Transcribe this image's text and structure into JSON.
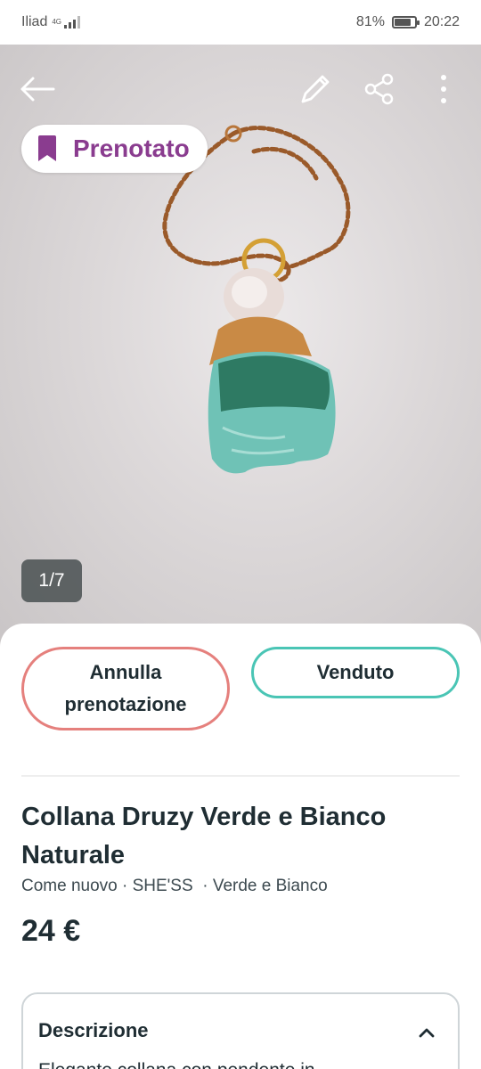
{
  "status_bar": {
    "carrier": "Iliad",
    "network": "4G",
    "battery_percent": "81%",
    "battery_level": 0.81,
    "time": "20:22"
  },
  "header": {
    "back_icon": "arrow-left-icon",
    "edit_icon": "pencil-icon",
    "share_icon": "share-icon",
    "more_icon": "more-vertical-icon"
  },
  "photo": {
    "status_badge": "Prenotato",
    "badge_icon": "bookmark-icon",
    "badge_color": "#8a3c8f",
    "counter": "1/7"
  },
  "actions": {
    "cancel_label_line1": "Annulla",
    "cancel_label_line2": "prenotazione",
    "cancel_color": "#e5807d",
    "sold_label": "Venduto",
    "sold_color": "#4ac5b5"
  },
  "item": {
    "title": "Collana Druzy Verde e Bianco Naturale",
    "meta": "Come nuovo · SHE'SS  · Verde e Bianco",
    "price": "24 €"
  },
  "description": {
    "heading": "Descrizione",
    "toggle_icon": "chevron-up-icon",
    "text_preview": "Elegante collana con pendente in"
  }
}
